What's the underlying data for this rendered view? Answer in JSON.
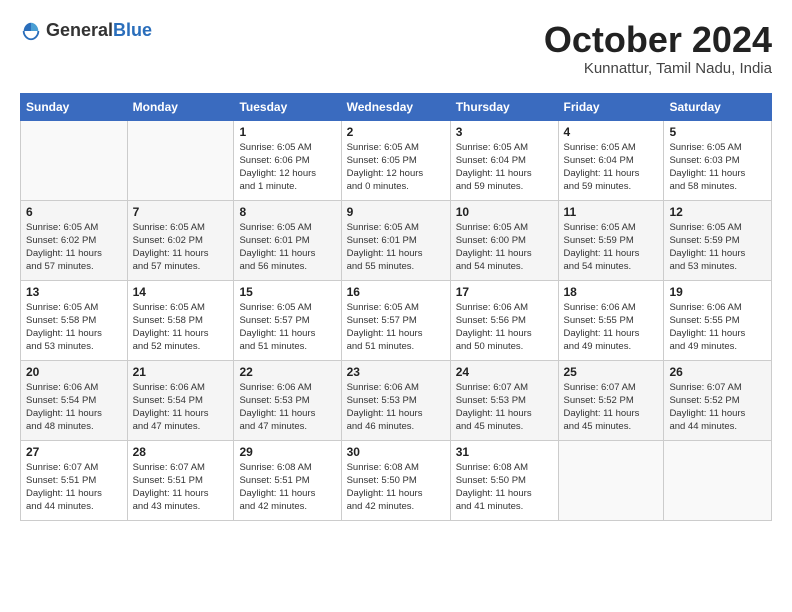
{
  "header": {
    "logo_general": "General",
    "logo_blue": "Blue",
    "month_title": "October 2024",
    "subtitle": "Kunnattur, Tamil Nadu, India"
  },
  "weekdays": [
    "Sunday",
    "Monday",
    "Tuesday",
    "Wednesday",
    "Thursday",
    "Friday",
    "Saturday"
  ],
  "weeks": [
    [
      {
        "day": "",
        "info": ""
      },
      {
        "day": "",
        "info": ""
      },
      {
        "day": "1",
        "info": "Sunrise: 6:05 AM\nSunset: 6:06 PM\nDaylight: 12 hours\nand 1 minute."
      },
      {
        "day": "2",
        "info": "Sunrise: 6:05 AM\nSunset: 6:05 PM\nDaylight: 12 hours\nand 0 minutes."
      },
      {
        "day": "3",
        "info": "Sunrise: 6:05 AM\nSunset: 6:04 PM\nDaylight: 11 hours\nand 59 minutes."
      },
      {
        "day": "4",
        "info": "Sunrise: 6:05 AM\nSunset: 6:04 PM\nDaylight: 11 hours\nand 59 minutes."
      },
      {
        "day": "5",
        "info": "Sunrise: 6:05 AM\nSunset: 6:03 PM\nDaylight: 11 hours\nand 58 minutes."
      }
    ],
    [
      {
        "day": "6",
        "info": "Sunrise: 6:05 AM\nSunset: 6:02 PM\nDaylight: 11 hours\nand 57 minutes."
      },
      {
        "day": "7",
        "info": "Sunrise: 6:05 AM\nSunset: 6:02 PM\nDaylight: 11 hours\nand 57 minutes."
      },
      {
        "day": "8",
        "info": "Sunrise: 6:05 AM\nSunset: 6:01 PM\nDaylight: 11 hours\nand 56 minutes."
      },
      {
        "day": "9",
        "info": "Sunrise: 6:05 AM\nSunset: 6:01 PM\nDaylight: 11 hours\nand 55 minutes."
      },
      {
        "day": "10",
        "info": "Sunrise: 6:05 AM\nSunset: 6:00 PM\nDaylight: 11 hours\nand 54 minutes."
      },
      {
        "day": "11",
        "info": "Sunrise: 6:05 AM\nSunset: 5:59 PM\nDaylight: 11 hours\nand 54 minutes."
      },
      {
        "day": "12",
        "info": "Sunrise: 6:05 AM\nSunset: 5:59 PM\nDaylight: 11 hours\nand 53 minutes."
      }
    ],
    [
      {
        "day": "13",
        "info": "Sunrise: 6:05 AM\nSunset: 5:58 PM\nDaylight: 11 hours\nand 53 minutes."
      },
      {
        "day": "14",
        "info": "Sunrise: 6:05 AM\nSunset: 5:58 PM\nDaylight: 11 hours\nand 52 minutes."
      },
      {
        "day": "15",
        "info": "Sunrise: 6:05 AM\nSunset: 5:57 PM\nDaylight: 11 hours\nand 51 minutes."
      },
      {
        "day": "16",
        "info": "Sunrise: 6:05 AM\nSunset: 5:57 PM\nDaylight: 11 hours\nand 51 minutes."
      },
      {
        "day": "17",
        "info": "Sunrise: 6:06 AM\nSunset: 5:56 PM\nDaylight: 11 hours\nand 50 minutes."
      },
      {
        "day": "18",
        "info": "Sunrise: 6:06 AM\nSunset: 5:55 PM\nDaylight: 11 hours\nand 49 minutes."
      },
      {
        "day": "19",
        "info": "Sunrise: 6:06 AM\nSunset: 5:55 PM\nDaylight: 11 hours\nand 49 minutes."
      }
    ],
    [
      {
        "day": "20",
        "info": "Sunrise: 6:06 AM\nSunset: 5:54 PM\nDaylight: 11 hours\nand 48 minutes."
      },
      {
        "day": "21",
        "info": "Sunrise: 6:06 AM\nSunset: 5:54 PM\nDaylight: 11 hours\nand 47 minutes."
      },
      {
        "day": "22",
        "info": "Sunrise: 6:06 AM\nSunset: 5:53 PM\nDaylight: 11 hours\nand 47 minutes."
      },
      {
        "day": "23",
        "info": "Sunrise: 6:06 AM\nSunset: 5:53 PM\nDaylight: 11 hours\nand 46 minutes."
      },
      {
        "day": "24",
        "info": "Sunrise: 6:07 AM\nSunset: 5:53 PM\nDaylight: 11 hours\nand 45 minutes."
      },
      {
        "day": "25",
        "info": "Sunrise: 6:07 AM\nSunset: 5:52 PM\nDaylight: 11 hours\nand 45 minutes."
      },
      {
        "day": "26",
        "info": "Sunrise: 6:07 AM\nSunset: 5:52 PM\nDaylight: 11 hours\nand 44 minutes."
      }
    ],
    [
      {
        "day": "27",
        "info": "Sunrise: 6:07 AM\nSunset: 5:51 PM\nDaylight: 11 hours\nand 44 minutes."
      },
      {
        "day": "28",
        "info": "Sunrise: 6:07 AM\nSunset: 5:51 PM\nDaylight: 11 hours\nand 43 minutes."
      },
      {
        "day": "29",
        "info": "Sunrise: 6:08 AM\nSunset: 5:51 PM\nDaylight: 11 hours\nand 42 minutes."
      },
      {
        "day": "30",
        "info": "Sunrise: 6:08 AM\nSunset: 5:50 PM\nDaylight: 11 hours\nand 42 minutes."
      },
      {
        "day": "31",
        "info": "Sunrise: 6:08 AM\nSunset: 5:50 PM\nDaylight: 11 hours\nand 41 minutes."
      },
      {
        "day": "",
        "info": ""
      },
      {
        "day": "",
        "info": ""
      }
    ]
  ]
}
